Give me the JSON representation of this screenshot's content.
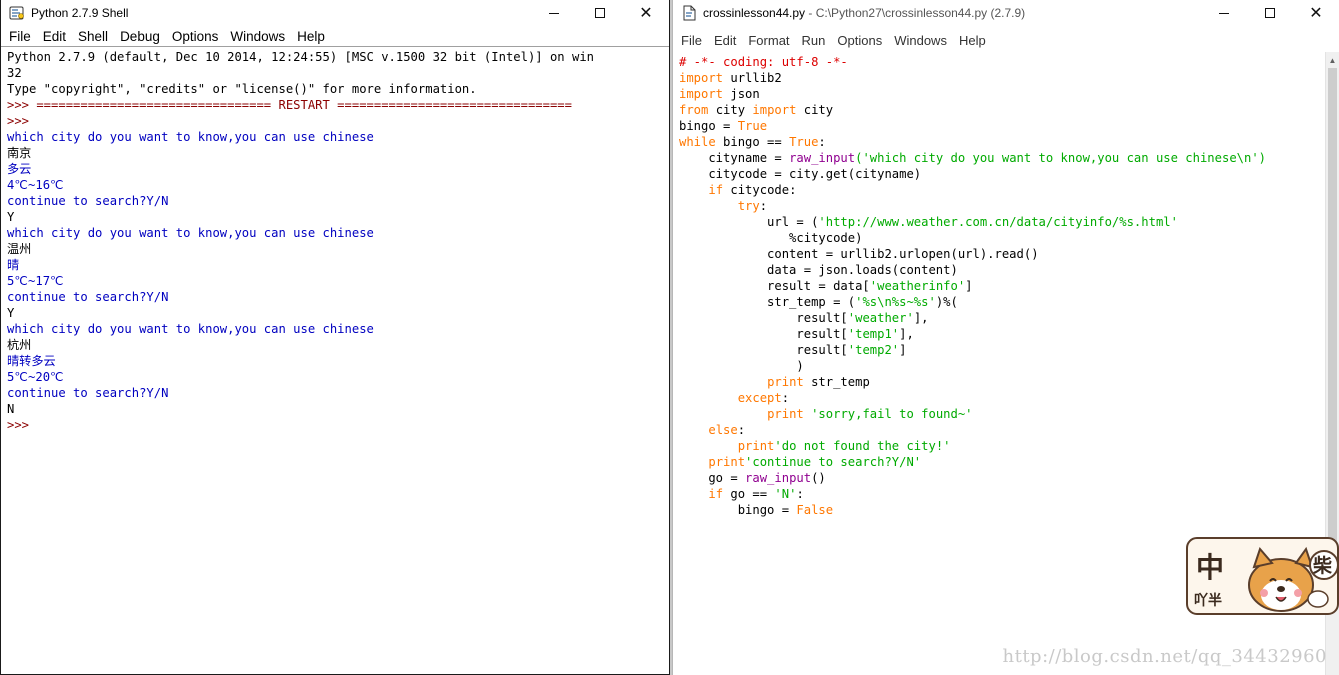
{
  "shell": {
    "title": "Python 2.7.9 Shell",
    "menu": [
      "File",
      "Edit",
      "Shell",
      "Debug",
      "Options",
      "Windows",
      "Help"
    ],
    "lines": [
      {
        "t": "Python 2.7.9 (default, Dec 10 2014, 12:24:55) [MSC v.1500 32 bit (Intel)] on win",
        "c": "c-out"
      },
      {
        "t": "32",
        "c": "c-out"
      },
      {
        "t": "Type \"copyright\", \"credits\" or \"license()\" for more information.",
        "c": "c-out"
      },
      {
        "t": ">>> ================================ RESTART ================================",
        "c": "c-prompt"
      },
      {
        "t": ">>> ",
        "c": "c-prompt"
      },
      {
        "t": "which city do you want to know,you can use chinese",
        "c": "c-blue"
      },
      {
        "t": "南京",
        "c": "c-out"
      },
      {
        "t": "多云",
        "c": "c-blue"
      },
      {
        "t": "4℃~16℃",
        "c": "c-blue"
      },
      {
        "t": "continue to search?Y/N",
        "c": "c-blue"
      },
      {
        "t": "Y",
        "c": "c-out"
      },
      {
        "t": "which city do you want to know,you can use chinese",
        "c": "c-blue"
      },
      {
        "t": "温州",
        "c": "c-out"
      },
      {
        "t": "晴",
        "c": "c-blue"
      },
      {
        "t": "5℃~17℃",
        "c": "c-blue"
      },
      {
        "t": "continue to search?Y/N",
        "c": "c-blue"
      },
      {
        "t": "Y",
        "c": "c-out"
      },
      {
        "t": "which city do you want to know,you can use chinese",
        "c": "c-blue"
      },
      {
        "t": "杭州",
        "c": "c-out"
      },
      {
        "t": "晴转多云",
        "c": "c-blue"
      },
      {
        "t": "5℃~20℃",
        "c": "c-blue"
      },
      {
        "t": "continue to search?Y/N",
        "c": "c-blue"
      },
      {
        "t": "N",
        "c": "c-out"
      },
      {
        "t": ">>> ",
        "c": "c-prompt"
      }
    ]
  },
  "editor": {
    "title_file": "crossinlesson44.py",
    "title_path": " - C:\\Python27\\crossinlesson44.py (2.7.9)",
    "menu": [
      "File",
      "Edit",
      "Format",
      "Run",
      "Options",
      "Windows",
      "Help"
    ],
    "code": [
      [
        [
          "cm",
          "# -*- coding: utf-8 -*-"
        ]
      ],
      [
        [
          "kw",
          "import"
        ],
        [
          "id",
          " urllib2"
        ]
      ],
      [
        [
          "kw",
          "import"
        ],
        [
          "id",
          " json"
        ]
      ],
      [
        [
          "kw",
          "from"
        ],
        [
          "id",
          " city "
        ],
        [
          "kw",
          "import"
        ],
        [
          "id",
          " city"
        ]
      ],
      [
        [
          "id",
          "bingo = "
        ],
        [
          "kw",
          "True"
        ]
      ],
      [
        [
          "kw",
          "while"
        ],
        [
          "id",
          " bingo == "
        ],
        [
          "kw",
          "True"
        ],
        [
          "id",
          ":"
        ]
      ],
      [
        [
          "id",
          "    cityname = "
        ],
        [
          "bi",
          "raw_input"
        ],
        [
          "str",
          "('which city do you want to know,you can use chinese\\n')"
        ]
      ],
      [
        [
          "id",
          "    citycode = city.get(cityname)"
        ]
      ],
      [
        [
          "id",
          "    "
        ],
        [
          "kw",
          "if"
        ],
        [
          "id",
          " citycode:"
        ]
      ],
      [
        [
          "id",
          "        "
        ],
        [
          "kw",
          "try"
        ],
        [
          "id",
          ":"
        ]
      ],
      [
        [
          "id",
          "            url = ("
        ],
        [
          "str",
          "'http://www.weather.com.cn/data/cityinfo/%s.html'"
        ]
      ],
      [
        [
          "id",
          "               %citycode)"
        ]
      ],
      [
        [
          "id",
          "            content = urllib2.urlopen(url).read()"
        ]
      ],
      [
        [
          "id",
          "            data = json.loads(content)"
        ]
      ],
      [
        [
          "id",
          "            result = data["
        ],
        [
          "str",
          "'weatherinfo'"
        ],
        [
          "id",
          "]"
        ]
      ],
      [
        [
          "id",
          "            str_temp = ("
        ],
        [
          "str",
          "'%s\\n%s~%s'"
        ],
        [
          "id",
          ")%("
        ]
      ],
      [
        [
          "id",
          "                result["
        ],
        [
          "str",
          "'weather'"
        ],
        [
          "id",
          "],"
        ]
      ],
      [
        [
          "id",
          "                result["
        ],
        [
          "str",
          "'temp1'"
        ],
        [
          "id",
          "],"
        ]
      ],
      [
        [
          "id",
          "                result["
        ],
        [
          "str",
          "'temp2'"
        ],
        [
          "id",
          "]"
        ]
      ],
      [
        [
          "id",
          "                )"
        ]
      ],
      [
        [
          "id",
          "            "
        ],
        [
          "kw",
          "print"
        ],
        [
          "id",
          " str_temp"
        ]
      ],
      [
        [
          "id",
          "        "
        ],
        [
          "kw",
          "except"
        ],
        [
          "id",
          ":"
        ]
      ],
      [
        [
          "id",
          "            "
        ],
        [
          "kw",
          "print"
        ],
        [
          "id",
          " "
        ],
        [
          "str",
          "'sorry,fail to found~'"
        ]
      ],
      [
        [
          "id",
          "    "
        ],
        [
          "kw",
          "else"
        ],
        [
          "id",
          ":"
        ]
      ],
      [
        [
          "id",
          "        "
        ],
        [
          "kw",
          "print"
        ],
        [
          "str",
          "'do not found the city!'"
        ]
      ],
      [
        [
          "id",
          "    "
        ],
        [
          "kw",
          "print"
        ],
        [
          "str",
          "'continue to search?Y/N'"
        ]
      ],
      [
        [
          "id",
          "    go = "
        ],
        [
          "bi",
          "raw_input"
        ],
        [
          "id",
          "()"
        ]
      ],
      [
        [
          "id",
          "    "
        ],
        [
          "kw",
          "if"
        ],
        [
          "id",
          " go == "
        ],
        [
          "str",
          "'N'"
        ],
        [
          "id",
          ":"
        ]
      ],
      [
        [
          "id",
          "        bingo = "
        ],
        [
          "kw",
          "False"
        ]
      ]
    ]
  },
  "watermark": "http://blog.csdn.net/qq_34432960",
  "logo": {
    "text_left": "中",
    "text_small": "吖半",
    "badge": "柴"
  },
  "colors": {
    "keyword": "#ff7700",
    "string": "#00aa00",
    "builtin": "#900090",
    "comment": "#dd0000",
    "output": "#0000c0"
  }
}
